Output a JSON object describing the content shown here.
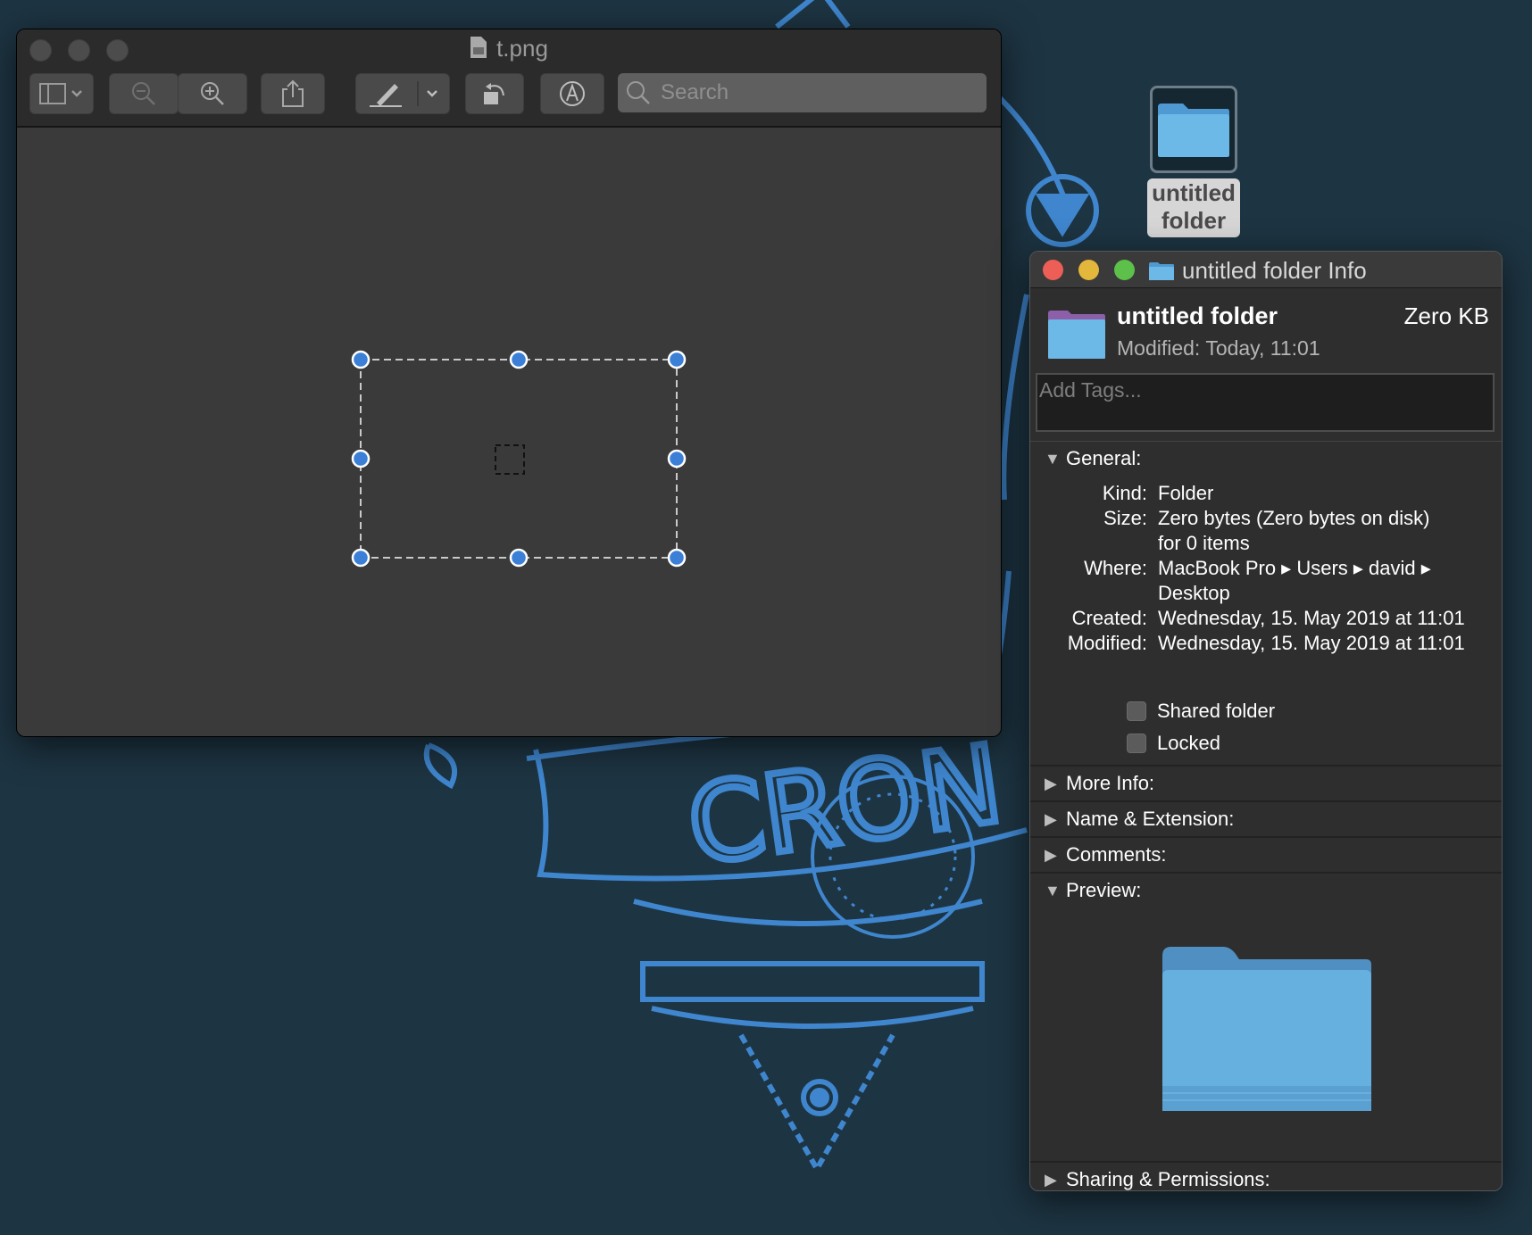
{
  "desktop": {
    "wallpaper_text": "CRON",
    "folder_label_line1": "untitled",
    "folder_label_line2": "folder"
  },
  "preview": {
    "title": "t.png",
    "search_placeholder": "Search",
    "toolbar": [
      "sidebar-toggle",
      "zoom-out",
      "zoom-in",
      "share",
      "markup",
      "rotate",
      "annotate"
    ]
  },
  "info": {
    "window_title": "untitled folder Info",
    "name": "untitled folder",
    "size_short": "Zero KB",
    "modified_label": "Modified:",
    "modified_value": "Today, 11:01",
    "tags_placeholder": "Add Tags...",
    "general": {
      "heading": "General:",
      "rows": [
        {
          "k": "Kind:",
          "v": "Folder"
        },
        {
          "k": "Size:",
          "v": "Zero bytes (Zero bytes on disk)"
        },
        {
          "k": "",
          "v": "for 0 items"
        },
        {
          "k": "Where:",
          "v": "MacBook Pro ▸ Users ▸ david ▸"
        },
        {
          "k": "",
          "v": "Desktop"
        },
        {
          "k": "Created:",
          "v": "Wednesday, 15. May 2019 at 11:01"
        },
        {
          "k": "Modified:",
          "v": "Wednesday, 15. May 2019 at 11:01"
        }
      ],
      "shared_label": "Shared folder",
      "locked_label": "Locked"
    },
    "more_info": "More Info:",
    "name_ext": "Name & Extension:",
    "comments": "Comments:",
    "preview": "Preview:",
    "sharing": "Sharing & Permissions:"
  },
  "colors": {
    "wallpaper_bg": "#1d3442",
    "wallpaper_art": "#3f86cf",
    "handle": "#3b7fd6",
    "folder_blue": "#63aee0"
  }
}
